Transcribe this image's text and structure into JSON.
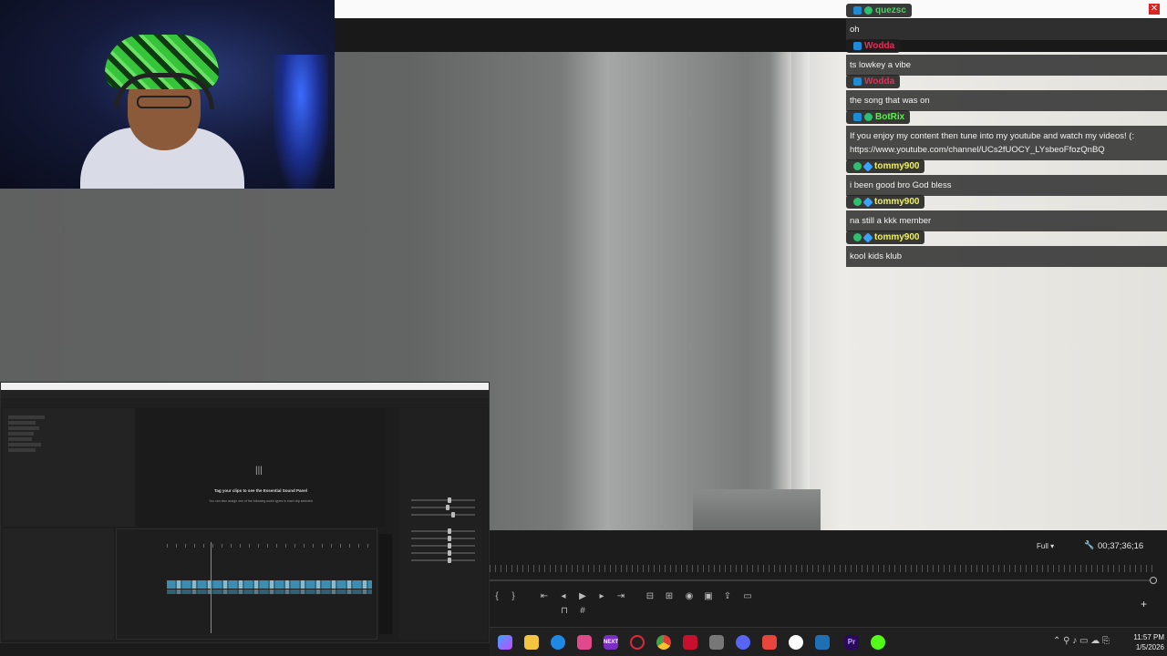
{
  "chat": {
    "messages": [
      {
        "user": "quezsc",
        "color": "#3fd85a",
        "text": "oh"
      },
      {
        "user": "Wodda",
        "color": "#e0305a",
        "text": "ts lowkey a vibe"
      },
      {
        "user": "Wodda",
        "color": "#e0305a",
        "text": "the song that was on"
      },
      {
        "user": "BotRix",
        "color": "#5cf04a",
        "text": "If you enjoy my content then tune into my youtube and watch my videos! (: https://www.youtube.com/channel/UCs2fUOCY_LYsbeoFfozQnBQ"
      },
      {
        "user": "tommy900",
        "color": "#f0f060",
        "text": "i been good bro God bless"
      },
      {
        "user": "tommy900",
        "color": "#f0f060",
        "text": "na still a kkk member"
      },
      {
        "user": "tommy900",
        "color": "#f0f060",
        "text": "kool kids klub"
      }
    ]
  },
  "premiere": {
    "essential_sound_title": "Tag your clips to see the Essential Sound Panel",
    "essential_sound_sub": "You can also assign one of the following audio types to each clip selected"
  },
  "program_monitor": {
    "fit_label": "Full",
    "timecode": "00;37;36;16"
  },
  "taskbar": {
    "time": "11:57 PM",
    "date": "1/5/2026"
  }
}
